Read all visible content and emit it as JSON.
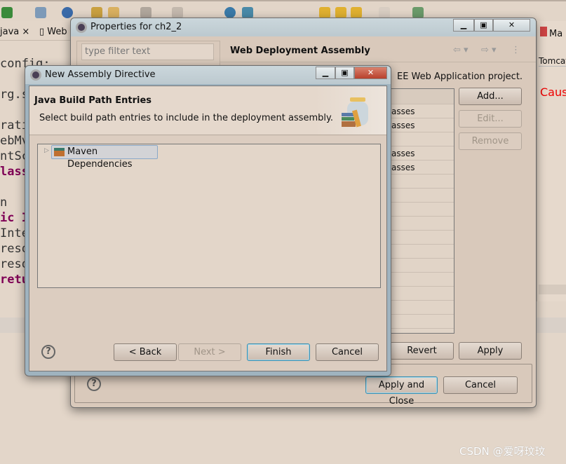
{
  "editor": {
    "tabs": [
      "java",
      "Web"
    ],
    "code_lines": [
      "config;",
      "rg.s",
      "rati",
      "ebMv",
      "ntSc",
      "lass",
      "n",
      "ic I",
      "Inte",
      "reso",
      "reso",
      "retu"
    ]
  },
  "right_panel": {
    "tab": "Ma",
    "label": "Tomcat",
    "error_text": "Caus"
  },
  "properties": {
    "title": "Properties for ch2_2",
    "filter_placeholder": "type filter text",
    "page_title": "Web Deployment Assembly",
    "description": "EE Web Application project.",
    "table_rows": [
      "asses",
      "asses",
      "",
      "asses",
      "asses"
    ],
    "add": "Add...",
    "edit": "Edit...",
    "remove": "Remove",
    "revert": "Revert",
    "apply": "Apply",
    "apply_close": "Apply and Close",
    "cancel": "Cancel"
  },
  "directive": {
    "title": "New Assembly Directive",
    "heading": "Java Build Path Entries",
    "description": "Select build path entries to include in the deployment assembly.",
    "tree_items": [
      "Maven Dependencies"
    ],
    "back": "< Back",
    "next": "Next >",
    "finish": "Finish",
    "cancel": "Cancel"
  },
  "watermark": "CSDN @爱呀玟玟"
}
